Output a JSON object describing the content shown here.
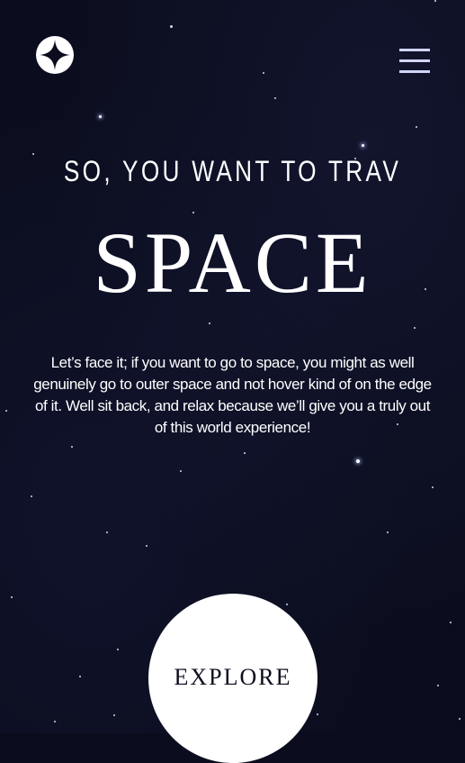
{
  "header": {
    "logo_icon": "star-logo-icon",
    "menu_icon": "hamburger-menu-icon"
  },
  "hero": {
    "eyebrow": "SO, YOU WANT TO TRAV",
    "title": "SPACE",
    "description": "Let’s face it; if you want to go to space, you might as well genuinely go to outer space and not hover kind of on the edge of it. Well sit back, and relax because we’ll give you a truly out of this world experience!",
    "cta_label": "EXPLORE"
  },
  "colors": {
    "background": "#0b0d1e",
    "text": "#ffffff",
    "menu": "#d0d6f9",
    "cta_text": "#0b0d1e"
  }
}
